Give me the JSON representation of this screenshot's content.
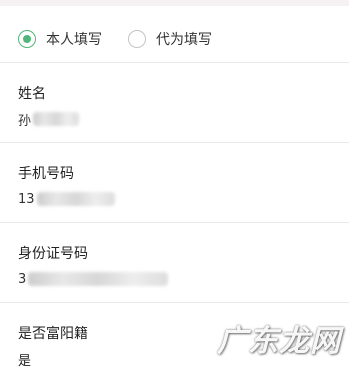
{
  "filler_type": {
    "options": [
      {
        "label": "本人填写",
        "selected": true
      },
      {
        "label": "代为填写",
        "selected": false
      }
    ]
  },
  "fields": {
    "name": {
      "label": "姓名",
      "value_visible": "孙"
    },
    "phone": {
      "label": "手机号码",
      "value_visible": "13"
    },
    "id_number": {
      "label": "身份证号码",
      "value_visible": "3"
    },
    "fuyang": {
      "label": "是否富阳籍",
      "value": "是"
    }
  },
  "watermark": "广东龙网",
  "colors": {
    "accent": "#52b67a",
    "divider": "#e9e9e9"
  }
}
